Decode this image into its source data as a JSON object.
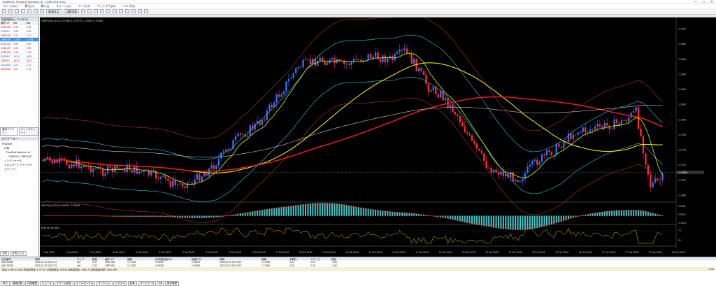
{
  "window": {
    "title": "12689151: FinalSoft Markets Ltd. - [GBPUSD,m15]"
  },
  "menu": [
    "ファイル(F)",
    "表示(V)",
    "挿入(I)",
    "チャート(C)",
    "ツール(T)",
    "ウィンドウ(W)",
    "ヘルプ(H)"
  ],
  "toolbar": {
    "new_order_label": "新規注文",
    "autotrade_label": "自動売買"
  },
  "market_watch": {
    "header": "気配値表示: 12:48:34",
    "columns": [
      "通貨ペア",
      "Bid",
      "Ask"
    ],
    "rows": [
      {
        "symbol": "EURUSD",
        "bid": "0.99",
        "ask": "0.99",
        "style": "red"
      },
      {
        "symbol": "USDJPY",
        "bid": "0.99",
        "ask": "0.99",
        "style": "blu"
      },
      {
        "symbol": "GBPUSD",
        "bid": "1.21",
        "ask": "1.21",
        "style": "red"
      },
      {
        "symbol": "GBPUSD",
        "bid": "1.17%",
        "ask": "1.17%",
        "style": "sel"
      },
      {
        "symbol": "AUDUSD",
        "bid": "0.69",
        "ask": "0.69",
        "style": "blu"
      },
      {
        "symbol": "USDCHF",
        "bid": "0.99",
        "ask": "0.99",
        "style": "red"
      },
      {
        "symbol": "USDCAD",
        "bid": "1.34",
        "ask": "1.34",
        "style": "red"
      },
      {
        "symbol": "EURJPY",
        "bid": "143.0",
        "ask": "143.0",
        "style": "blu"
      },
      {
        "symbol": "GBPJPY",
        "bid": "163.0",
        "ask": "163.0",
        "style": "red"
      },
      {
        "symbol": "XAUUSD",
        "bid": "1.21",
        "ask": "1.21",
        "style": "blu"
      },
      {
        "symbol": "NZDUSD",
        "bid": "1.21",
        "ask": "1.21",
        "style": "red"
      }
    ],
    "tabs": [
      "通貨ペアリスト",
      "ティックチャート"
    ]
  },
  "navigator": {
    "header": "ナビゲーター",
    "items": [
      "FinalSoft",
      "口座",
      "FinalSoft Markets Ltd",
      "12689151: GBPUSD",
      "インディケータ",
      "エキスパートアドバイザ",
      "スクリプト"
    ],
    "tabs": [
      "全般",
      "お気に入り"
    ]
  },
  "chart": {
    "symbol_label": "GBPUSD,m15 1.17060 1.17079 1.17039 1.17060",
    "price_ticks": [
      "1.1900",
      "1.1880",
      "1.1860",
      "1.1840",
      "1.1820",
      "1.1800",
      "1.1780",
      "1.1760",
      "1.1740",
      "1.1720",
      "1.1700",
      "1.1680"
    ],
    "current_price": "1.17060",
    "time_ticks": [
      "7 Feb 2023",
      "7 Feb 08:00",
      "7 Feb 16:00",
      "8 Feb 00:00",
      "8 Feb 08:00",
      "8 Feb 16:00",
      "9 Feb 00:00",
      "9 Feb 08:00",
      "9 Feb 16:00",
      "10 Feb 00:00",
      "10 Feb 08:00",
      "10 Feb 16:00",
      "13 Feb 00:00",
      "13 Feb 08:00",
      "13 Feb 16:00",
      "14 Feb 00:00",
      "14 Feb 08:00",
      "14 Feb 16:00",
      "15 Feb 00:00",
      "15 Feb 08:00",
      "15 Feb 16:00",
      "16 Feb 00:00",
      "16 Feb 08:00",
      "16 Feb 16:00",
      "17 Feb 00:00",
      "17 Feb 08:00",
      "17 Feb 16:00",
      "20 Feb 00:00"
    ],
    "macd_label": "MACD(12,26,9) -0.00054 -0.00026",
    "macd_ticks": [
      "0.0010",
      "0.0000",
      "-0.0010"
    ],
    "rsi_label": "RSI(14) 38.4622",
    "rsi_ticks": [
      "70",
      "30"
    ],
    "colors": {
      "bull": "#2f6fff",
      "bear": "#ff2a2a",
      "ma_long": "#ff1a1a",
      "ma_mid": "#ffff00",
      "bb": "#32c8e6"
    }
  },
  "terminal": {
    "columns": [
      "注文番号",
      "時間",
      "タイプ",
      "数量",
      "通貨ペア",
      "価格",
      "決済逆指値(S/L)",
      "指値(T/P)",
      "時間",
      "価格",
      "手数料",
      "スワップ",
      "損益"
    ],
    "rows": [
      {
        "ticket": "601478382",
        "time": "2023.02.20 08:27:33",
        "type": "sell",
        "lots": "0.02",
        "symbol": "GBPUSD",
        "price": "1.17060",
        "sl": "0.00000",
        "tp": "0.00000",
        "price2": "1.17060",
        "commission": "0.00",
        "swap": "0.00",
        "profit": "-1.64"
      },
      {
        "ticket": "601478399",
        "time": "2023.02.20 08:27:33",
        "type": "sell",
        "lots": "2.00",
        "symbol": "GBPUSD",
        "price": "1.17060",
        "sl": "0.00000",
        "tp": "0.00000",
        "price2": "1.17060",
        "commission": "0.00",
        "swap": "0.00",
        "profit": "-3.46"
      }
    ],
    "balance_line": "残高: 5 082.63 USD  有効証拠金: 5 077.37  必要証拠金: 225.63  余剰証拠金: 4 851.74  証拠金維持率: 2250.24%",
    "balance_total": "-5.26",
    "tabs": [
      "取引",
      "運用比較",
      "口座履歴",
      "ニュース",
      "アラーム設定",
      "メールボックス",
      "マーケット",
      "シグナル",
      "記事",
      "コードベース",
      "EA",
      "操作履歴"
    ]
  }
}
